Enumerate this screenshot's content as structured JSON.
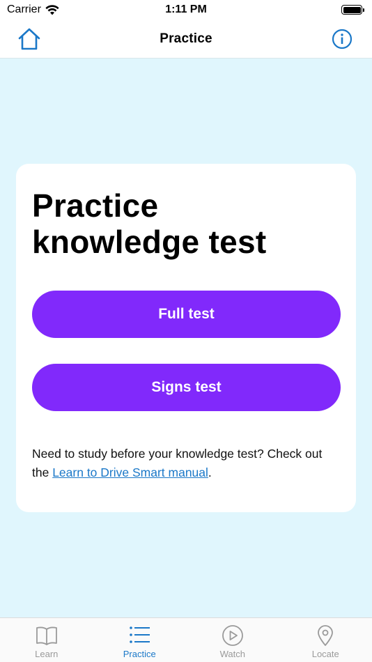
{
  "status_bar": {
    "carrier": "Carrier",
    "time": "1:11 PM"
  },
  "nav": {
    "title": "Practice",
    "home_icon": "home-icon",
    "info_icon": "info-icon"
  },
  "card": {
    "title_line1": "Practice",
    "title_line2": "knowledge test",
    "full_test_label": "Full test",
    "signs_test_label": "Signs test",
    "note_prefix": "Need to study before your knowledge test? Check out the ",
    "note_link": "Learn to Drive Smart manual",
    "note_suffix": "."
  },
  "tabs": [
    {
      "label": "Learn",
      "icon": "book-icon",
      "active": false
    },
    {
      "label": "Practice",
      "icon": "list-icon",
      "active": true
    },
    {
      "label": "Watch",
      "icon": "play-icon",
      "active": false
    },
    {
      "label": "Locate",
      "icon": "location-pin-icon",
      "active": false
    }
  ],
  "colors": {
    "accent_blue": "#1b78c8",
    "button_purple": "#8129fb",
    "background_light_blue": "#e0f6fd"
  }
}
